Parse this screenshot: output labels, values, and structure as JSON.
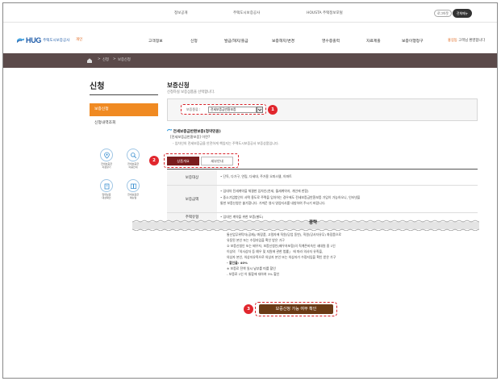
{
  "topbar": {
    "links": [
      "정보공개",
      "주택도시보증공사",
      "HOUSTA 주택정보포털"
    ],
    "login_label": "로그아웃",
    "join_label": "전체메뉴"
  },
  "header": {
    "logo_text": "HUG",
    "logo_sub": "주택도시보증공사",
    "logo_tag": "개인",
    "nav": [
      "고객정보",
      "신청",
      "발급/해지/출금",
      "보증해지/변경",
      "영수증출력",
      "자료제출",
      "보증이행청구"
    ],
    "nav_tail_highlight": "홍길동",
    "nav_tail_rest": "고객님 환영합니다"
  },
  "breadcrumb": {
    "items": [
      "신청",
      "보증신청"
    ]
  },
  "sidebar": {
    "title": "신청",
    "active_item": "보증신청",
    "item": "신청내역조회",
    "quick_icons": [
      {
        "icon": "map-pin-icon",
        "label_1": "전세보증금",
        "label_2": "지점찾기"
      },
      {
        "icon": "search-icon",
        "label_1": "전세보증금",
        "label_2": "이용안내"
      },
      {
        "icon": "building-icon",
        "label_1": "임대보증",
        "label_2": "대상확인"
      },
      {
        "icon": "book-icon",
        "label_1": "전세보증금",
        "label_2": "매뉴얼"
      }
    ]
  },
  "main": {
    "title": "보증신청",
    "subtitle": "신청하실 보증상품을 선택합니다.",
    "select_label": "보증종류 :",
    "select_value": "전세보증금반환보증",
    "guarantee_heading": "전세보증금반환보증(청약민원)",
    "guarantee_line1": "[전세보증금반환보증] 이란?",
    "guarantee_line2": "- 임차인의 전세보증금을 안전하게 책임지는 주택도시보증공사 보증상품입니다.",
    "tab_active": "상품개요",
    "tab_other": "세부안내",
    "rows": [
      {
        "header": "보증대상",
        "lines": [
          "• 단독, 다가구, 연립, 다세대, 주거용 오피스텔, 아파트"
        ]
      },
      {
        "header": "보증금액",
        "lines": [
          "• 임대차 전세계약을 체결한 임차인(연세, 월세계약자, 개인에 한함)",
          "• 중소기업법인이 사택 용도로 주택을 임차하는 경우에도 전세보증금반환보증 가입이 가능하오니, 인터넷을",
          "  통한 보증신청은 불가합니다. 가까운 영사 영업지사를 내방하여 주시기 바랍니다."
        ]
      },
      {
        "header": "주택유형",
        "lines": [
          "• 임대인 계약을 위한 보증(별도)"
        ]
      }
    ],
    "cut_label": "중략",
    "lower_lines": [
      "통신업무위탁자(공제)/ 화장품, 고령자에 직원(당업 동반), 직원(당사자유무) 화장품으로",
      "유동된 본인 또는 수정자임을 확인 받은 가구",
      "② 보증신청인 또는 배우자, 보증신청인(배우자포함)의 직계존비속인 세대원 중 1인",
      "이상의 「의사상자 등 예우 및 지원에 관한 법률」 에 따라 의사자 유족을,",
      "의상자 본인, 의상자유족으로 의상자 본인 또는 의상자가 수정지임을 확인 받은 가구",
      "- 할인율: 40%",
      "※ 보증료 전액 일시 납부를 따를 할인",
      "  - 보증료 1인 이 통합에 대하여 3% 할인"
    ],
    "cta_label": "보증신청 가능 여부 확인"
  },
  "annotations": [
    "1",
    "2",
    "3"
  ],
  "colors": {
    "accent_orange": "#f08a22",
    "brand_blue": "#1c5aa8",
    "dark_strip": "#5b4a4a",
    "tab_active": "#7a1d1d",
    "cta_brown": "#6b3b16",
    "annotation_red": "#d8232a"
  }
}
